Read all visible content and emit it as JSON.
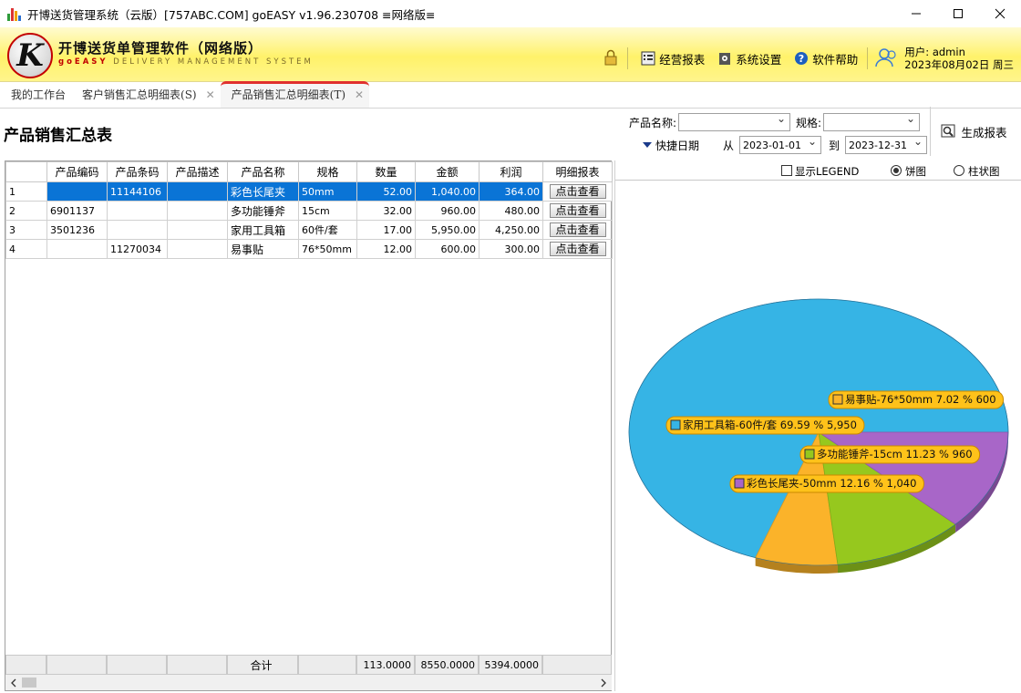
{
  "window": {
    "title": "开博送货管理系统（云版）[757ABC.COM]   goEASY v1.96.230708   ≡网络版≡"
  },
  "header": {
    "logo_title": "开博送货单管理软件（网络版）",
    "logo_sub_brand": "goEASY",
    "logo_sub": " DELIVERY MANAGEMENT SYSTEM",
    "menu": [
      {
        "label": "经营报表",
        "icon": "report-icon"
      },
      {
        "label": "系统设置",
        "icon": "settings-icon"
      },
      {
        "label": "软件帮助",
        "icon": "help-icon"
      }
    ],
    "user_label": "用户: admin",
    "date_label": "2023年08月02日 周三"
  },
  "tabs": [
    {
      "label": "我的工作台"
    },
    {
      "label": "客户销售汇总明细表(S)"
    },
    {
      "label": "产品销售汇总明细表(T)",
      "active": true
    }
  ],
  "report": {
    "title": "产品销售汇总表",
    "product_name_label": "产品名称:",
    "product_name_value": "",
    "spec_label": "规格:",
    "spec_value": "",
    "quick_date_label": "快捷日期",
    "from_label": "从",
    "from_date": "2023-01-01",
    "to_label": "到",
    "to_date": "2023-12-31",
    "generate_label": "生成报表"
  },
  "grid": {
    "columns": [
      "",
      "产品编码",
      "产品条码",
      "产品描述",
      "产品名称",
      "规格",
      "数量",
      "金额",
      "利润",
      "明细报表"
    ],
    "rows": [
      {
        "n": "1",
        "code": "",
        "barcode": "11144106",
        "desc": "",
        "name": "彩色长尾夹",
        "spec": "50mm",
        "qty": "52.00",
        "amount": "1,040.00",
        "profit": "364.00",
        "btn": "点击查看"
      },
      {
        "n": "2",
        "code": "6901137",
        "barcode": "",
        "desc": "",
        "name": "多功能锤斧",
        "spec": "15cm",
        "qty": "32.00",
        "amount": "960.00",
        "profit": "480.00",
        "btn": "点击查看"
      },
      {
        "n": "3",
        "code": "3501236",
        "barcode": "",
        "desc": "",
        "name": "家用工具箱",
        "spec": "60件/套",
        "qty": "17.00",
        "amount": "5,950.00",
        "profit": "4,250.00",
        "btn": "点击查看"
      },
      {
        "n": "4",
        "code": "",
        "barcode": "11270034",
        "desc": "",
        "name": "易事贴",
        "spec": "76*50mm",
        "qty": "12.00",
        "amount": "600.00",
        "profit": "300.00",
        "btn": "点击查看"
      }
    ],
    "footer": {
      "label": "合计",
      "qty": "113.0000",
      "amount": "8550.0000",
      "profit": "5394.0000"
    }
  },
  "chart_options": {
    "legend_label": "显示LEGEND",
    "pie_label": "饼图",
    "bar_label": "柱状图",
    "selected": "pie"
  },
  "chart_data": {
    "type": "pie",
    "slices": [
      {
        "label": "家用工具箱-60件/套 69.59 % 5,950",
        "value": 5950,
        "percent": 69.59,
        "color": "#36b4e5"
      },
      {
        "label": "易事贴-76*50mm 7.02 % 600",
        "value": 600,
        "percent": 7.02,
        "color": "#fbb32a"
      },
      {
        "label": "多功能锤斧-15cm 11.23 % 960",
        "value": 960,
        "percent": 11.23,
        "color": "#96c81e"
      },
      {
        "label": "彩色长尾夹-50mm 12.16 % 1,040",
        "value": 1040,
        "percent": 12.16,
        "color": "#a866c8"
      }
    ]
  }
}
